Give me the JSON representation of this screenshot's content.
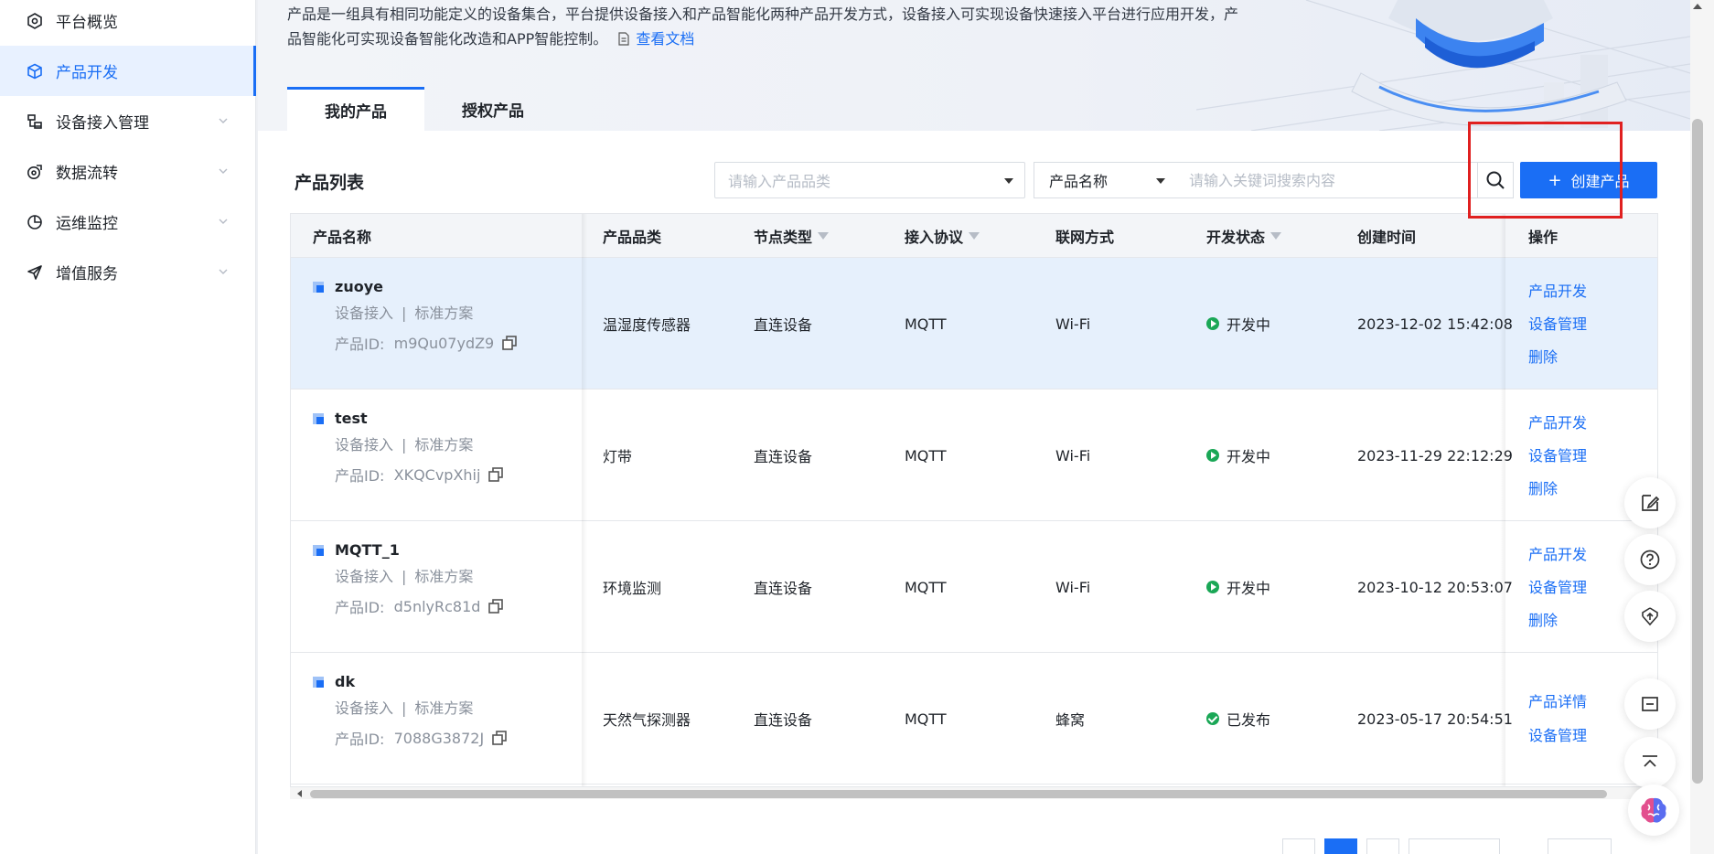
{
  "sidebar": {
    "items": [
      {
        "label": "平台概览",
        "icon": "overview-icon",
        "active": false,
        "expandable": false
      },
      {
        "label": "产品开发",
        "icon": "cube-icon",
        "active": true,
        "expandable": false
      },
      {
        "label": "设备接入管理",
        "icon": "device-icon",
        "active": false,
        "expandable": true
      },
      {
        "label": "数据流转",
        "icon": "data-flow-icon",
        "active": false,
        "expandable": true
      },
      {
        "label": "运维监控",
        "icon": "monitor-icon",
        "active": false,
        "expandable": true
      },
      {
        "label": "增值服务",
        "icon": "send-icon",
        "active": false,
        "expandable": true
      }
    ]
  },
  "banner": {
    "description": "产品是一组具有相同功能定义的设备集合，平台提供设备接入和产品智能化两种产品开发方式，设备接入可实现设备快速接入平台进行应用开发，产品智能化可实现设备智能化改造和APP智能控制。",
    "doc_link": "查看文档"
  },
  "tabs": [
    {
      "label": "我的产品",
      "active": true
    },
    {
      "label": "授权产品",
      "active": false
    }
  ],
  "list": {
    "title": "产品列表",
    "category_placeholder": "请输入产品品类",
    "search_field": "产品名称",
    "search_placeholder": "请输入关键词搜索内容",
    "create_label": "创建产品"
  },
  "table": {
    "headers": {
      "name": "产品名称",
      "category": "产品品类",
      "node_type": "节点类型",
      "protocol": "接入协议",
      "network": "联网方式",
      "status": "开发状态",
      "created": "创建时间",
      "actions": "操作"
    },
    "rows": [
      {
        "name": "zuoye",
        "access": "设备接入",
        "plan": "标准方案",
        "id_label": "产品ID:",
        "id": "m9Qu07ydZ9",
        "category": "温湿度传感器",
        "node_type": "直连设备",
        "protocol": "MQTT",
        "network": "Wi-Fi",
        "status": "开发中",
        "created": "2023-12-02 15:42:08",
        "actions": [
          "产品开发",
          "设备管理",
          "删除"
        ]
      },
      {
        "name": "test",
        "access": "设备接入",
        "plan": "标准方案",
        "id_label": "产品ID:",
        "id": "XKQCvpXhij",
        "category": "灯带",
        "node_type": "直连设备",
        "protocol": "MQTT",
        "network": "Wi-Fi",
        "status": "开发中",
        "created": "2023-11-29 22:12:29",
        "actions": [
          "产品开发",
          "设备管理",
          "删除"
        ]
      },
      {
        "name": "MQTT_1",
        "access": "设备接入",
        "plan": "标准方案",
        "id_label": "产品ID:",
        "id": "d5nlyRc81d",
        "category": "环境监测",
        "node_type": "直连设备",
        "protocol": "MQTT",
        "network": "Wi-Fi",
        "status": "开发中",
        "created": "2023-10-12 20:53:07",
        "actions": [
          "产品开发",
          "设备管理",
          "删除"
        ]
      },
      {
        "name": "dk",
        "access": "设备接入",
        "plan": "标准方案",
        "id_label": "产品ID:",
        "id": "7088G3872J",
        "category": "天然气探测器",
        "node_type": "直连设备",
        "protocol": "MQTT",
        "network": "蜂窝",
        "status": "已发布",
        "created": "2023-05-17 20:54:51",
        "actions": [
          "产品详情",
          "设备管理"
        ]
      }
    ]
  },
  "floating_tools": [
    "edit-icon",
    "help-icon",
    "upload-icon",
    "minimize-icon",
    "back-to-top-icon",
    "ai-assistant-icon"
  ],
  "colors": {
    "accent": "#1a6ef5",
    "status_green": "#1aa756",
    "highlight_red": "#e02020"
  }
}
